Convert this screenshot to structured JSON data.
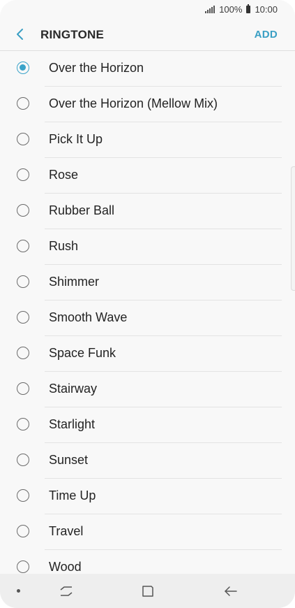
{
  "status_bar": {
    "battery": "100%",
    "time": "10:00"
  },
  "app_bar": {
    "title": "RINGTONE",
    "add_label": "ADD"
  },
  "colors": {
    "accent": "#3aa3c9",
    "text": "#232323",
    "background": "#f8f8f8"
  },
  "ringtones": [
    {
      "label": "Over the Horizon",
      "selected": true
    },
    {
      "label": "Over the Horizon (Mellow Mix)",
      "selected": false
    },
    {
      "label": "Pick It Up",
      "selected": false
    },
    {
      "label": "Rose",
      "selected": false
    },
    {
      "label": "Rubber Ball",
      "selected": false
    },
    {
      "label": "Rush",
      "selected": false
    },
    {
      "label": "Shimmer",
      "selected": false
    },
    {
      "label": "Smooth Wave",
      "selected": false
    },
    {
      "label": "Space Funk",
      "selected": false
    },
    {
      "label": "Stairway",
      "selected": false
    },
    {
      "label": "Starlight",
      "selected": false
    },
    {
      "label": "Sunset",
      "selected": false
    },
    {
      "label": "Time Up",
      "selected": false
    },
    {
      "label": "Travel",
      "selected": false
    },
    {
      "label": "Wood",
      "selected": false
    }
  ],
  "nav_bar": {
    "icons": [
      "dot-icon",
      "recent-apps-icon",
      "home-icon",
      "back-arrow-icon"
    ]
  }
}
